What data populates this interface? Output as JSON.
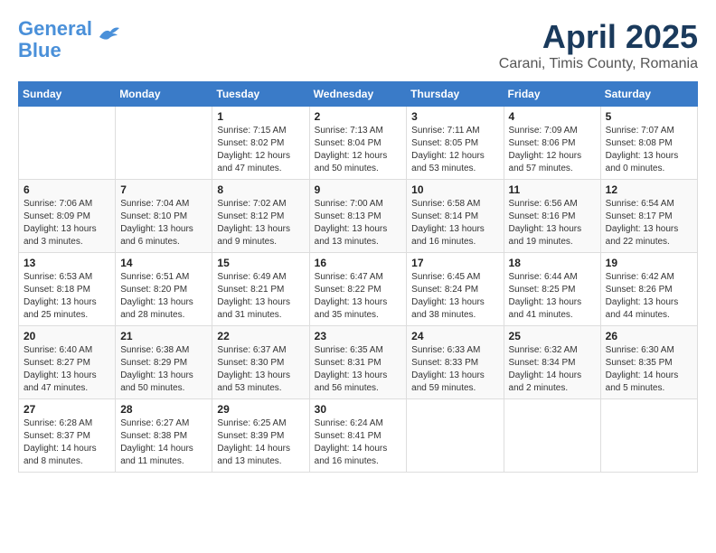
{
  "header": {
    "logo_line1": "General",
    "logo_line2": "Blue",
    "month_title": "April 2025",
    "location": "Carani, Timis County, Romania"
  },
  "weekdays": [
    "Sunday",
    "Monday",
    "Tuesday",
    "Wednesday",
    "Thursday",
    "Friday",
    "Saturday"
  ],
  "weeks": [
    [
      {
        "day": "",
        "info": ""
      },
      {
        "day": "",
        "info": ""
      },
      {
        "day": "1",
        "info": "Sunrise: 7:15 AM\nSunset: 8:02 PM\nDaylight: 12 hours\nand 47 minutes."
      },
      {
        "day": "2",
        "info": "Sunrise: 7:13 AM\nSunset: 8:04 PM\nDaylight: 12 hours\nand 50 minutes."
      },
      {
        "day": "3",
        "info": "Sunrise: 7:11 AM\nSunset: 8:05 PM\nDaylight: 12 hours\nand 53 minutes."
      },
      {
        "day": "4",
        "info": "Sunrise: 7:09 AM\nSunset: 8:06 PM\nDaylight: 12 hours\nand 57 minutes."
      },
      {
        "day": "5",
        "info": "Sunrise: 7:07 AM\nSunset: 8:08 PM\nDaylight: 13 hours\nand 0 minutes."
      }
    ],
    [
      {
        "day": "6",
        "info": "Sunrise: 7:06 AM\nSunset: 8:09 PM\nDaylight: 13 hours\nand 3 minutes."
      },
      {
        "day": "7",
        "info": "Sunrise: 7:04 AM\nSunset: 8:10 PM\nDaylight: 13 hours\nand 6 minutes."
      },
      {
        "day": "8",
        "info": "Sunrise: 7:02 AM\nSunset: 8:12 PM\nDaylight: 13 hours\nand 9 minutes."
      },
      {
        "day": "9",
        "info": "Sunrise: 7:00 AM\nSunset: 8:13 PM\nDaylight: 13 hours\nand 13 minutes."
      },
      {
        "day": "10",
        "info": "Sunrise: 6:58 AM\nSunset: 8:14 PM\nDaylight: 13 hours\nand 16 minutes."
      },
      {
        "day": "11",
        "info": "Sunrise: 6:56 AM\nSunset: 8:16 PM\nDaylight: 13 hours\nand 19 minutes."
      },
      {
        "day": "12",
        "info": "Sunrise: 6:54 AM\nSunset: 8:17 PM\nDaylight: 13 hours\nand 22 minutes."
      }
    ],
    [
      {
        "day": "13",
        "info": "Sunrise: 6:53 AM\nSunset: 8:18 PM\nDaylight: 13 hours\nand 25 minutes."
      },
      {
        "day": "14",
        "info": "Sunrise: 6:51 AM\nSunset: 8:20 PM\nDaylight: 13 hours\nand 28 minutes."
      },
      {
        "day": "15",
        "info": "Sunrise: 6:49 AM\nSunset: 8:21 PM\nDaylight: 13 hours\nand 31 minutes."
      },
      {
        "day": "16",
        "info": "Sunrise: 6:47 AM\nSunset: 8:22 PM\nDaylight: 13 hours\nand 35 minutes."
      },
      {
        "day": "17",
        "info": "Sunrise: 6:45 AM\nSunset: 8:24 PM\nDaylight: 13 hours\nand 38 minutes."
      },
      {
        "day": "18",
        "info": "Sunrise: 6:44 AM\nSunset: 8:25 PM\nDaylight: 13 hours\nand 41 minutes."
      },
      {
        "day": "19",
        "info": "Sunrise: 6:42 AM\nSunset: 8:26 PM\nDaylight: 13 hours\nand 44 minutes."
      }
    ],
    [
      {
        "day": "20",
        "info": "Sunrise: 6:40 AM\nSunset: 8:27 PM\nDaylight: 13 hours\nand 47 minutes."
      },
      {
        "day": "21",
        "info": "Sunrise: 6:38 AM\nSunset: 8:29 PM\nDaylight: 13 hours\nand 50 minutes."
      },
      {
        "day": "22",
        "info": "Sunrise: 6:37 AM\nSunset: 8:30 PM\nDaylight: 13 hours\nand 53 minutes."
      },
      {
        "day": "23",
        "info": "Sunrise: 6:35 AM\nSunset: 8:31 PM\nDaylight: 13 hours\nand 56 minutes."
      },
      {
        "day": "24",
        "info": "Sunrise: 6:33 AM\nSunset: 8:33 PM\nDaylight: 13 hours\nand 59 minutes."
      },
      {
        "day": "25",
        "info": "Sunrise: 6:32 AM\nSunset: 8:34 PM\nDaylight: 14 hours\nand 2 minutes."
      },
      {
        "day": "26",
        "info": "Sunrise: 6:30 AM\nSunset: 8:35 PM\nDaylight: 14 hours\nand 5 minutes."
      }
    ],
    [
      {
        "day": "27",
        "info": "Sunrise: 6:28 AM\nSunset: 8:37 PM\nDaylight: 14 hours\nand 8 minutes."
      },
      {
        "day": "28",
        "info": "Sunrise: 6:27 AM\nSunset: 8:38 PM\nDaylight: 14 hours\nand 11 minutes."
      },
      {
        "day": "29",
        "info": "Sunrise: 6:25 AM\nSunset: 8:39 PM\nDaylight: 14 hours\nand 13 minutes."
      },
      {
        "day": "30",
        "info": "Sunrise: 6:24 AM\nSunset: 8:41 PM\nDaylight: 14 hours\nand 16 minutes."
      },
      {
        "day": "",
        "info": ""
      },
      {
        "day": "",
        "info": ""
      },
      {
        "day": "",
        "info": ""
      }
    ]
  ]
}
